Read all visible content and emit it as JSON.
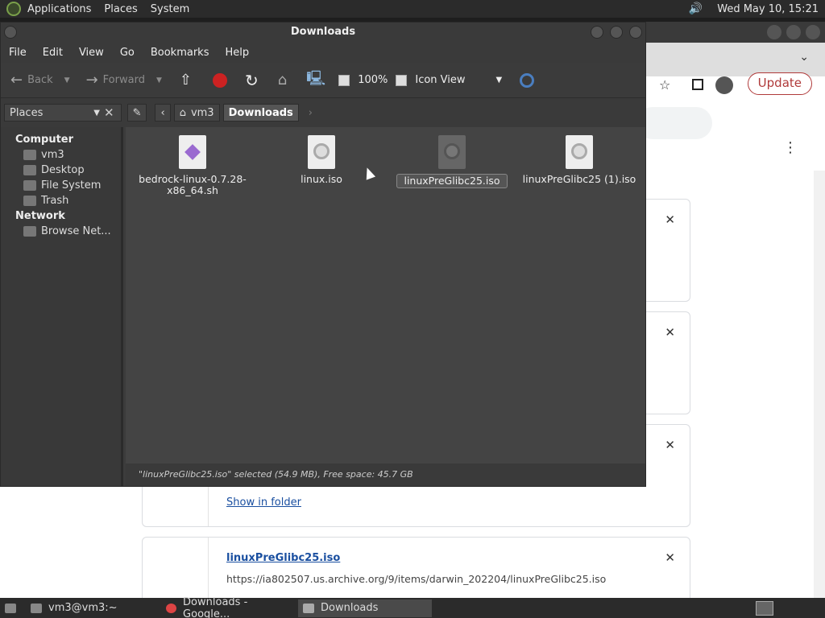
{
  "top_panel": {
    "menus": [
      "Applications",
      "Places",
      "System"
    ],
    "clock": "Wed May 10, 15:21"
  },
  "chrome": {
    "update_label": "Update",
    "downloads": [
      {
        "link": "Show in folder"
      },
      {
        "filename": "linuxPreGlibc25.iso",
        "url": "https://ia802507.us.archive.org/9/items/darwin_202204/linuxPreGlibc25.iso"
      }
    ]
  },
  "file_manager": {
    "title": "Downloads",
    "menu": [
      "File",
      "Edit",
      "View",
      "Go",
      "Bookmarks",
      "Help"
    ],
    "toolbar": {
      "back": "Back",
      "forward": "Forward",
      "zoom": "100%",
      "view_mode": "Icon View"
    },
    "places_label": "Places",
    "breadcrumbs": [
      "vm3",
      "Downloads"
    ],
    "sidebar": {
      "computer_heading": "Computer",
      "computer_items": [
        "vm3",
        "Desktop",
        "File System",
        "Trash"
      ],
      "network_heading": "Network",
      "network_items": [
        "Browse Net..."
      ]
    },
    "files": [
      {
        "name": "bedrock-linux-0.7.28-x86_64.sh",
        "line1": "bedrock-linux-0.7.28-",
        "line2": "x86_64.sh"
      },
      {
        "name": "linux.iso"
      },
      {
        "name": "linuxPreGlibc25.iso"
      },
      {
        "name": "linuxPreGlibc25 (1).iso"
      }
    ],
    "status": "\"linuxPreGlibc25.iso\" selected (54.9 MB), Free space: 45.7 GB"
  },
  "taskbar": {
    "tasks": [
      "vm3@vm3:~",
      "Downloads - Google...",
      "Downloads"
    ]
  }
}
